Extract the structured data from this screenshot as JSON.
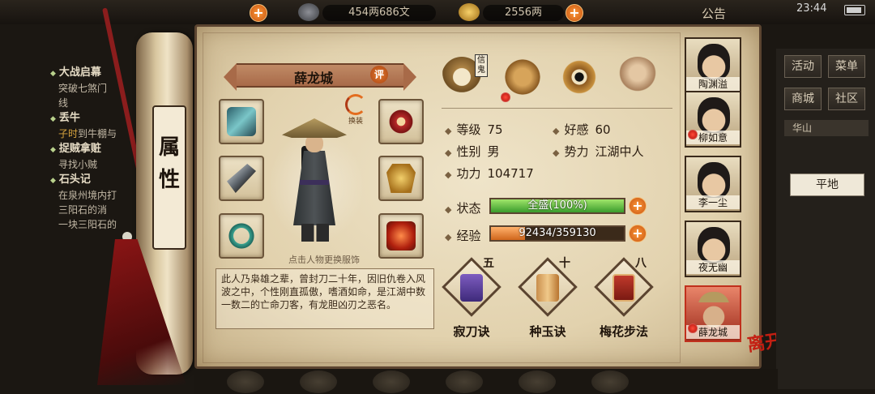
{
  "topbar": {
    "resources": [
      "454两686文",
      "2556两"
    ],
    "notice": "公告",
    "clock": "23:44"
  },
  "quests": [
    {
      "title": "大战启幕",
      "lines": [
        "突破七煞门",
        "线"
      ]
    },
    {
      "title": "丢牛",
      "lines_rich": [
        {
          "hl": "子时",
          "text": "到牛棚与"
        }
      ]
    },
    {
      "title": "捉贼拿赃",
      "lines": [
        "寻找小贼"
      ]
    },
    {
      "title": "石头记",
      "lines": [
        "在泉州境内打",
        "三阳石的消",
        "一块三阳石的"
      ]
    }
  ],
  "scroll_seal": [
    "属",
    "性"
  ],
  "character": {
    "name": "薛龙城",
    "rate_badge": "评",
    "outfit_label": "换装",
    "hint": "点击人物更换服饰",
    "description": "此人乃枭雄之辈，曾封刀二十年，因旧仇卷入风波之中，个性刚直孤傲，嗜酒如命，是江湖中数一数二的亡命刀客，有龙胆凶刃之恶名。",
    "status_tag": "信\n鬼"
  },
  "attributes": {
    "level_label": "等级",
    "level": "75",
    "favor_label": "好感",
    "favor": "60",
    "gender_label": "性别",
    "gender": "男",
    "faction_label": "势力",
    "faction": "江湖中人",
    "power_label": "功力",
    "power": "104717"
  },
  "bars": {
    "state_label": "状态",
    "state_text": "全盛(100%)",
    "state_fraction": 1.0,
    "exp_label": "经验",
    "exp_text": "92434/359130",
    "exp_fraction": 0.257
  },
  "skills": [
    {
      "name": "寂刀诀",
      "level": "五"
    },
    {
      "name": "种玉诀",
      "level": "十"
    },
    {
      "name": "梅花步法",
      "level": "八"
    }
  ],
  "team": [
    "陶渊溢",
    "柳如意",
    "李一尘",
    "夜无幽",
    "薛龙城"
  ],
  "leave_label": "离开",
  "side_menu": {
    "buttons": [
      "活动",
      "菜单",
      "商城",
      "社区"
    ],
    "location": "华山",
    "terrain": "平地"
  },
  "colors": {
    "parchment": "#e2d2ae",
    "state_bar": "#3a9c2c",
    "exp_bar": "#d0661c",
    "accent_red": "#c41f12"
  }
}
